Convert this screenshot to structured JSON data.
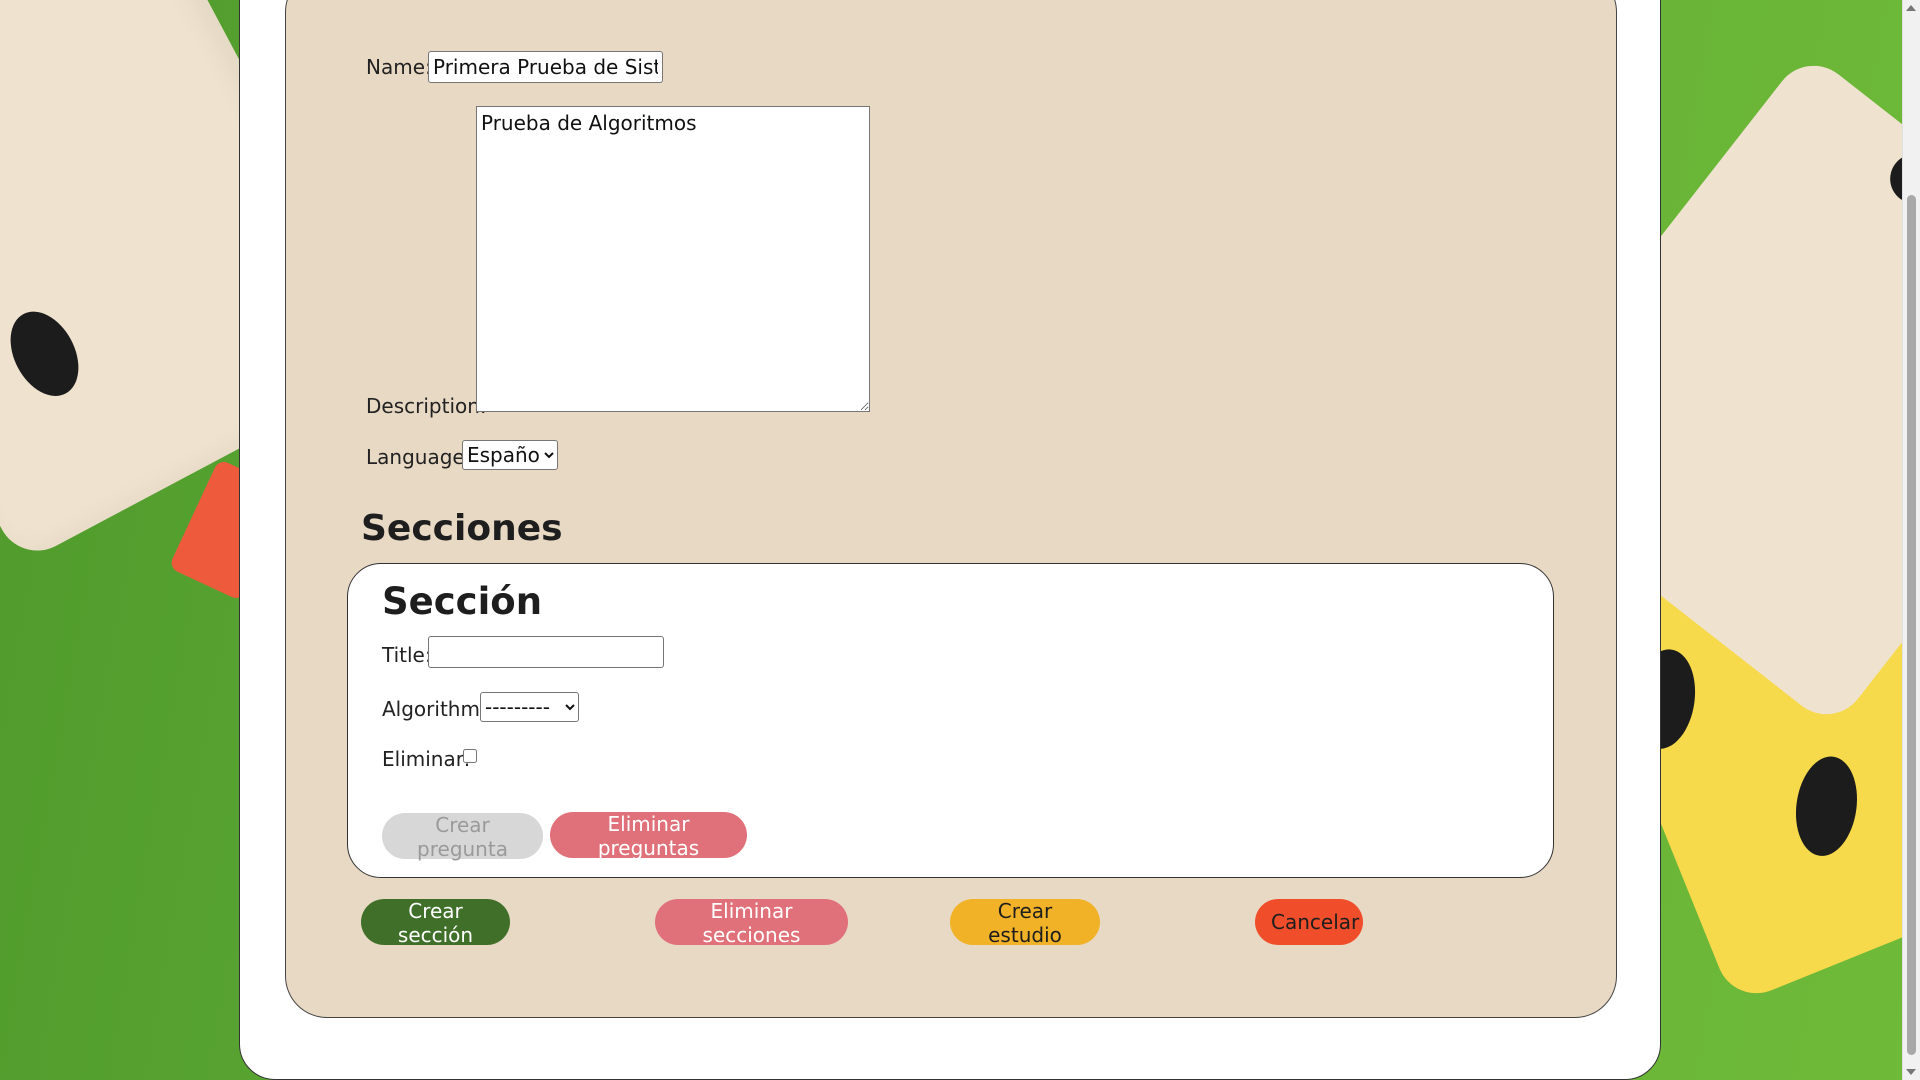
{
  "form": {
    "name_label": "Name:",
    "name_value": "Primera Prueba de Sistem",
    "description_label": "Description:",
    "description_value": "Prueba de Algoritmos",
    "language_label": "Language:",
    "language_selected": "Español"
  },
  "sections": {
    "heading": "Secciones",
    "card": {
      "heading": "Sección",
      "title_label": "Title:",
      "title_value": "",
      "algorithm_label": "Algorithm:",
      "algorithm_selected": "---------",
      "delete_label": "Eliminar:",
      "delete_checked": false,
      "create_question_button": "Crear pregunta",
      "delete_questions_button": "Eliminar preguntas"
    }
  },
  "actions": {
    "create_section": "Crear sección",
    "delete_sections": "Eliminar secciones",
    "create_study": "Crear estudio",
    "cancel": "Cancelar"
  },
  "colors": {
    "panel": "#e8d9c4",
    "green_button": "#3f6f28",
    "pink_button": "#e0717a",
    "yellow_button": "#f1b227",
    "orange_button": "#f04d2b",
    "background_green": "#5aa633"
  }
}
